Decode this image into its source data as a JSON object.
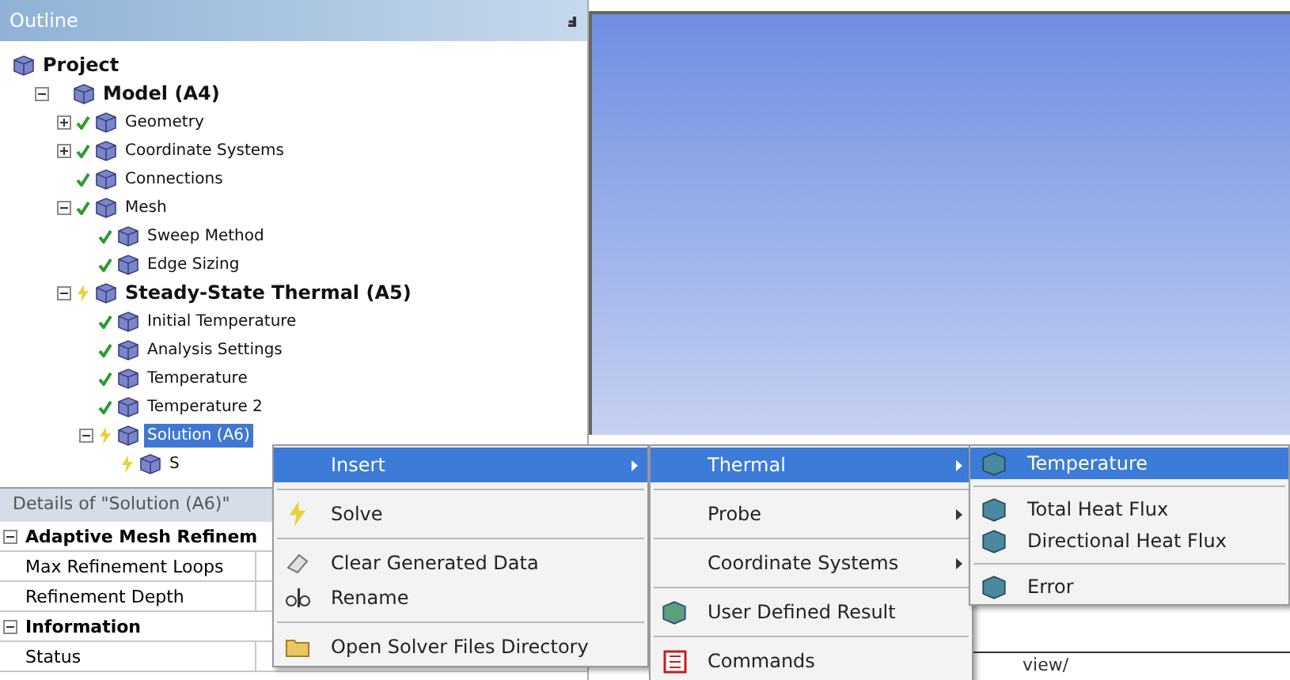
{
  "outline": {
    "title": "Outline",
    "pin": "ⅎ",
    "tree": [
      {
        "label": "Project",
        "bold": true,
        "children": [
          {
            "label": "Model (A4)",
            "bold": true,
            "expanded": true,
            "children": [
              {
                "label": "Geometry",
                "bold": false,
                "done": true,
                "expanded": false,
                "has_children": true
              },
              {
                "label": "Coordinate Systems",
                "bold": false,
                "done": true,
                "expanded": false,
                "has_children": true
              },
              {
                "label": "Connections",
                "bold": false,
                "done": true
              },
              {
                "label": "Mesh",
                "bold": false,
                "done": true,
                "expanded": true,
                "children": [
                  {
                    "label": "Sweep Method",
                    "bold": false,
                    "done": true
                  },
                  {
                    "label": "Edge Sizing",
                    "bold": false,
                    "done": true
                  }
                ]
              },
              {
                "label": "Steady-State Thermal (A5)",
                "bold": true,
                "done": false,
                "expanded": true,
                "children": [
                  {
                    "label": "Initial Temperature",
                    "bold": false,
                    "done": true
                  },
                  {
                    "label": "Analysis Settings",
                    "bold": false,
                    "done": true
                  },
                  {
                    "label": "Temperature",
                    "bold": false,
                    "done": true
                  },
                  {
                    "label": "Temperature 2",
                    "bold": false,
                    "done": true
                  },
                  {
                    "label": "Solution (A6)",
                    "bold": false,
                    "done": false,
                    "selected": true,
                    "expanded": true,
                    "children": [
                      {
                        "label": "S",
                        "bold": false,
                        "done": false
                      }
                    ]
                  }
                ]
              }
            ]
          }
        ]
      }
    ]
  },
  "details": {
    "title": "Details of \"Solution (A6)\"",
    "rows": [
      {
        "kind": "group",
        "label": "Adaptive Mesh Refinem"
      },
      {
        "kind": "field",
        "label": "Max Refinement Loops"
      },
      {
        "kind": "field",
        "label": "Refinement Depth"
      },
      {
        "kind": "group",
        "label": "Information"
      },
      {
        "kind": "field",
        "label": "Status"
      }
    ]
  },
  "viewport_tabs": [
    "view/"
  ],
  "context_menu": [
    {
      "kind": "item",
      "label": "Insert",
      "submenu": true,
      "selected": true
    },
    {
      "kind": "separator"
    },
    {
      "kind": "item",
      "label": "Solve",
      "submenu": false,
      "selected": false
    },
    {
      "kind": "separator"
    },
    {
      "kind": "item",
      "label": "Clear Generated Data",
      "submenu": false,
      "selected": false
    },
    {
      "kind": "item",
      "label": "Rename",
      "submenu": false,
      "selected": false
    },
    {
      "kind": "separator"
    },
    {
      "kind": "item",
      "label": "Open Solver Files Directory",
      "submenu": false,
      "selected": false
    }
  ],
  "insert_menu": [
    {
      "kind": "item",
      "label": "Thermal",
      "submenu": true,
      "selected": true
    },
    {
      "kind": "separator"
    },
    {
      "kind": "item",
      "label": "Probe",
      "submenu": true,
      "selected": false
    },
    {
      "kind": "separator"
    },
    {
      "kind": "item",
      "label": "Coordinate Systems",
      "submenu": true,
      "selected": false
    },
    {
      "kind": "separator"
    },
    {
      "kind": "item",
      "label": "User Defined Result",
      "submenu": false,
      "selected": false
    },
    {
      "kind": "separator"
    },
    {
      "kind": "item",
      "label": "Commands",
      "submenu": false,
      "selected": false
    }
  ],
  "thermal_menu": [
    {
      "kind": "item",
      "label": "Temperature",
      "submenu": false,
      "selected": true
    },
    {
      "kind": "separator"
    },
    {
      "kind": "item",
      "label": "Total Heat Flux",
      "submenu": false,
      "selected": false
    },
    {
      "kind": "item",
      "label": "Directional Heat Flux",
      "submenu": false,
      "selected": false
    },
    {
      "kind": "separator"
    },
    {
      "kind": "item",
      "label": "Error",
      "submenu": false,
      "selected": false
    }
  ]
}
